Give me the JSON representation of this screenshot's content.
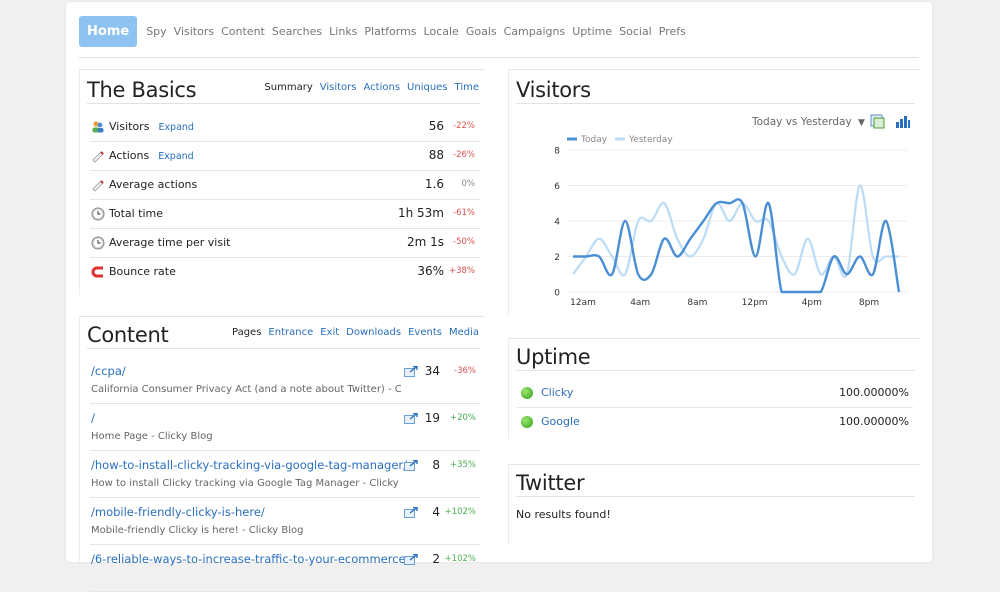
{
  "nav": {
    "home": "Home",
    "items": [
      "Spy",
      "Visitors",
      "Content",
      "Searches",
      "Links",
      "Platforms",
      "Locale",
      "Goals",
      "Campaigns",
      "Uptime",
      "Social",
      "Prefs"
    ]
  },
  "basics": {
    "title": "The Basics",
    "tabs": [
      "Summary",
      "Visitors",
      "Actions",
      "Uniques",
      "Time"
    ],
    "rows": [
      {
        "label": "Visitors",
        "expand": "Expand",
        "value": "56",
        "change": "-22%",
        "icon": "visitors-icon"
      },
      {
        "label": "Actions",
        "expand": "Expand",
        "value": "88",
        "change": "-26%",
        "icon": "actions-icon"
      },
      {
        "label": "Average actions",
        "expand": "",
        "value": "1.6",
        "change": "0%",
        "icon": "actions-icon"
      },
      {
        "label": "Total time",
        "expand": "",
        "value": "1h 53m",
        "change": "-61%",
        "icon": "clock-icon"
      },
      {
        "label": "Average time per visit",
        "expand": "",
        "value": "2m 1s",
        "change": "-50%",
        "icon": "clock-icon"
      },
      {
        "label": "Bounce rate",
        "expand": "",
        "value": "36%",
        "change": "+38%",
        "icon": "bounce-icon"
      }
    ]
  },
  "content": {
    "title": "Content",
    "tabs": [
      "Pages",
      "Entrance",
      "Exit",
      "Downloads",
      "Events",
      "Media"
    ],
    "rows": [
      {
        "path": "/ccpa/",
        "desc": "California Consumer Privacy Act (and a note about Twitter) - C...",
        "value": "34",
        "change": "-36%"
      },
      {
        "path": "/",
        "desc": "Home Page - Clicky Blog",
        "value": "19",
        "change": "+20%"
      },
      {
        "path": "/how-to-install-clicky-tracking-via-google-tag-manager/",
        "desc": "How to install Clicky tracking via Google Tag Manager - Clicky ...",
        "value": "8",
        "change": "+35%"
      },
      {
        "path": "/mobile-friendly-clicky-is-here/",
        "desc": "Mobile-friendly Clicky is here! - Clicky Blog",
        "value": "4",
        "change": "+102%"
      },
      {
        "path": "/6-reliable-ways-to-increase-traffic-to-your-ecommerce",
        "desc": "",
        "value": "2",
        "change": "+102%"
      }
    ]
  },
  "visitors": {
    "title": "Visitors",
    "compare": "Today vs Yesterday",
    "legend": [
      "Today",
      "Yesterday"
    ]
  },
  "uptime": {
    "title": "Uptime",
    "rows": [
      {
        "name": "Clicky",
        "value": "100.00000%"
      },
      {
        "name": "Google",
        "value": "100.00000%"
      }
    ]
  },
  "twitter": {
    "title": "Twitter",
    "message": "No results found!"
  },
  "colors": {
    "today": "#4a8fd4",
    "yesterday": "#bcdcf5",
    "accent": "#2a6fbd",
    "home": "#8ec2f0"
  },
  "chart_data": {
    "type": "line",
    "x": [
      0,
      1,
      2,
      3,
      4,
      5,
      6,
      7,
      8,
      9,
      10,
      11,
      12,
      13,
      14,
      15,
      16,
      17,
      18,
      19,
      20,
      21,
      22,
      23
    ],
    "xticks": [
      "12am",
      "4am",
      "8am",
      "12pm",
      "4pm",
      "8pm"
    ],
    "yticks": [
      "0",
      "2",
      "4",
      "6",
      "8"
    ],
    "ylim": [
      0,
      8
    ],
    "series": [
      {
        "name": "Today",
        "values": [
          2,
          2,
          2,
          1,
          4,
          1,
          1,
          3,
          2,
          3,
          4,
          5,
          5,
          5,
          2,
          5,
          0,
          0,
          0,
          0,
          2,
          1,
          2,
          1,
          4,
          0
        ],
        "color": "#4a8fd4"
      },
      {
        "name": "Yesterday",
        "values": [
          1,
          2,
          3,
          2,
          1,
          4,
          4,
          5,
          3,
          2,
          3,
          5,
          4,
          5,
          4,
          4,
          2,
          1,
          3,
          1,
          2,
          1,
          6,
          2,
          2,
          2
        ],
        "color": "#bcdcf5"
      }
    ]
  }
}
